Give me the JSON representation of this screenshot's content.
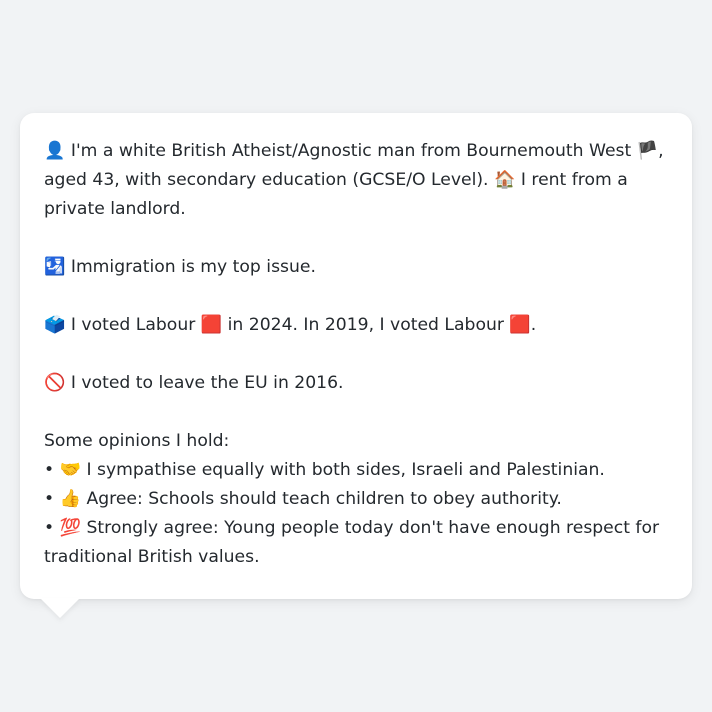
{
  "persona": {
    "bio": {
      "icon": "person-silhouette-icon",
      "icon_glyph": "👤",
      "text_1": "I'm a white British Atheist/Agnostic man from Bournemouth West",
      "flag_icon": "england-flag-icon",
      "flag_glyph": "🏴",
      "text_2": ", aged 43, with secondary education (GCSE/O Level).",
      "house_icon": "house-icon",
      "house_glyph": "🏠",
      "text_3": "I rent from a private landlord."
    },
    "top_issue": {
      "icon": "passport-control-icon",
      "icon_glyph": "🛂",
      "text": "Immigration is my top issue."
    },
    "voting": {
      "icon": "ballot-box-icon",
      "icon_glyph": "🗳️",
      "text_1": "I voted Labour",
      "party_icon_1": "red-square-icon",
      "party_glyph_1": "🟥",
      "text_2": "in 2024. In 2019, I voted Labour",
      "party_icon_2": "red-square-icon",
      "party_glyph_2": "🟥",
      "text_3": "."
    },
    "brexit": {
      "icon": "prohibited-icon",
      "icon_glyph": "🚫",
      "text": "I voted to leave the EU in 2016."
    },
    "opinions": {
      "heading": "Some opinions I hold:",
      "items": [
        {
          "bullet": "•",
          "icon": "handshake-icon",
          "icon_glyph": "🤝",
          "text": "I sympathise equally with both sides, Israeli and Palestinian."
        },
        {
          "bullet": "•",
          "icon": "thumbs-up-icon",
          "icon_glyph": "👍",
          "text": "Agree: Schools should teach children to obey authority."
        },
        {
          "bullet": "•",
          "icon": "hundred-points-icon",
          "icon_glyph": "💯",
          "text": "Strongly agree: Young people today don't have enough respect for traditional British values."
        }
      ]
    }
  },
  "colors": {
    "background": "#f1f3f5",
    "bubble": "#ffffff",
    "text": "#24292e"
  }
}
